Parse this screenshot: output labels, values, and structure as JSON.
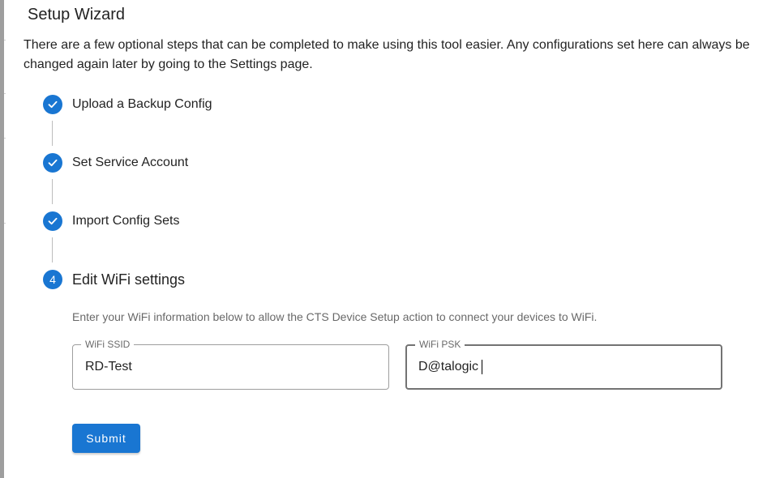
{
  "wizard": {
    "title": "Setup Wizard",
    "intro": "There are a few optional steps that can be completed to make using this tool easier. Any configurations set here can always be changed again later by going to the Settings page."
  },
  "steps": [
    {
      "label": "Upload a Backup Config",
      "status": "completed"
    },
    {
      "label": "Set Service Account",
      "status": "completed"
    },
    {
      "label": "Import Config Sets",
      "status": "completed"
    },
    {
      "label": "Edit WiFi settings",
      "status": "active",
      "number": "4"
    }
  ],
  "wifi": {
    "helper": "Enter your WiFi information below to allow the CTS Device Setup action to connect your devices to WiFi.",
    "ssid": {
      "label": "WiFi SSID",
      "value": "RD-Test"
    },
    "psk": {
      "label": "WiFi PSK",
      "value": "D@talogic"
    },
    "submit_label": "Submit"
  },
  "colors": {
    "accent": "#1976d2"
  },
  "icons": {
    "completed_step": "check-icon"
  }
}
